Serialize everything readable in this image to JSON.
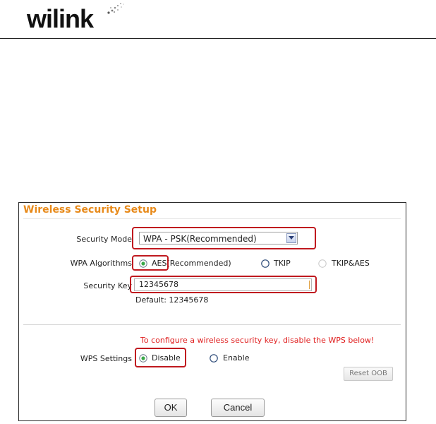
{
  "header": {
    "logo_text": "wilink"
  },
  "panel": {
    "title": "Wireless Security Setup",
    "security_mode": {
      "label": "Security Mode",
      "selected": "WPA - PSK(Recommended)"
    },
    "wpa_algorithms": {
      "label": "WPA Algorithms",
      "options": [
        {
          "label": "AES(Recommended)",
          "selected": true
        },
        {
          "label": "TKIP",
          "selected": false
        },
        {
          "label": "TKIP&AES",
          "selected": false
        }
      ]
    },
    "security_key": {
      "label": "Security Key",
      "value": "12345678",
      "default_hint": "Default: 12345678"
    },
    "wps_warning": "To configure a wireless security key, disable the WPS below!",
    "wps_settings": {
      "label": "WPS Settings",
      "options": [
        {
          "label": "Disable",
          "selected": true
        },
        {
          "label": "Enable",
          "selected": false
        }
      ]
    },
    "reset_oob_label": "Reset OOB",
    "ok_label": "OK",
    "cancel_label": "Cancel"
  },
  "colors": {
    "title_orange": "#e88a1a",
    "warning_red": "#e02020",
    "highlight_red": "#c0191f",
    "radio_green": "#3aa84a"
  }
}
